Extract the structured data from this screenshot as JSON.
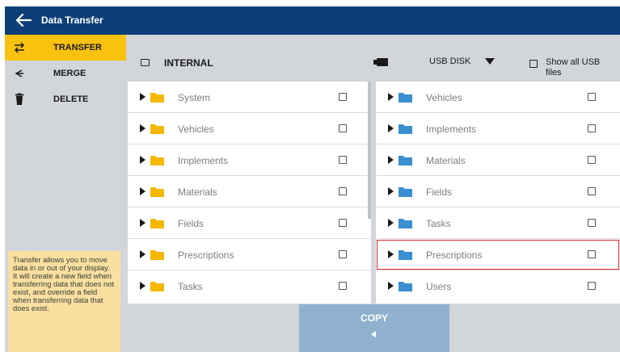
{
  "title_bar": {
    "title": "Data Transfer"
  },
  "sidebar": {
    "items": [
      {
        "label": "TRANSFER",
        "active": true
      },
      {
        "label": "MERGE",
        "active": false
      },
      {
        "label": "DELETE",
        "active": false
      }
    ],
    "help_text": "Transfer allows you to move data in or out of your display. It will create a new field when transferring data that does not exist, and override a field when transferring data that does exist."
  },
  "internal": {
    "label": "INTERNAL",
    "folders": [
      {
        "name": "System",
        "checked": false
      },
      {
        "name": "Vehicles",
        "checked": false
      },
      {
        "name": "Implements",
        "checked": false
      },
      {
        "name": "Materials",
        "checked": false
      },
      {
        "name": "Fields",
        "checked": false
      },
      {
        "name": "Prescriptions",
        "checked": false
      },
      {
        "name": "Tasks",
        "checked": false
      }
    ]
  },
  "usb": {
    "selected": "USB DISK",
    "show_all_label": "Show all USB files",
    "show_all_checked": false,
    "folders": [
      {
        "name": "Vehicles",
        "checked": false
      },
      {
        "name": "Implements",
        "checked": false
      },
      {
        "name": "Materials",
        "checked": false
      },
      {
        "name": "Fields",
        "checked": false
      },
      {
        "name": "Tasks",
        "checked": false
      },
      {
        "name": "Prescriptions",
        "checked": false,
        "highlighted": true
      },
      {
        "name": "Users",
        "checked": false
      }
    ]
  },
  "copy_button": {
    "label": "COPY"
  },
  "colors": {
    "title_bar": "#0c3f78",
    "active_tab": "#f9c20f",
    "internal_folder": "#f5b800",
    "usb_folder": "#3a8fd0",
    "copy_button": "#8fb1cf",
    "highlight": "#e0282e"
  }
}
